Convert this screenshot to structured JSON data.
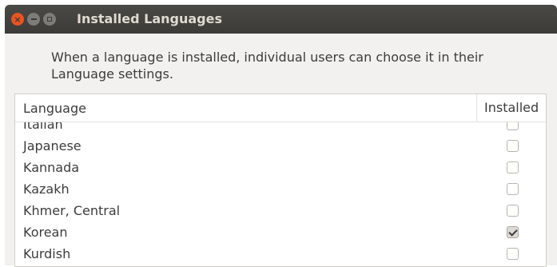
{
  "window": {
    "title": "Installed Languages",
    "description": "When a language is installed, individual users can choose it in their Language settings."
  },
  "table": {
    "columns": [
      "Language",
      "Installed"
    ],
    "rows": [
      {
        "name": "Italian",
        "installed": false
      },
      {
        "name": "Japanese",
        "installed": false
      },
      {
        "name": "Kannada",
        "installed": false
      },
      {
        "name": "Kazakh",
        "installed": false
      },
      {
        "name": "Khmer, Central",
        "installed": false
      },
      {
        "name": "Korean",
        "installed": true
      },
      {
        "name": "Kurdish",
        "installed": false
      }
    ]
  },
  "colors": {
    "titlebar": "#3c3b37",
    "close_button": "#e95420",
    "window_bg": "#f2f1f0"
  }
}
